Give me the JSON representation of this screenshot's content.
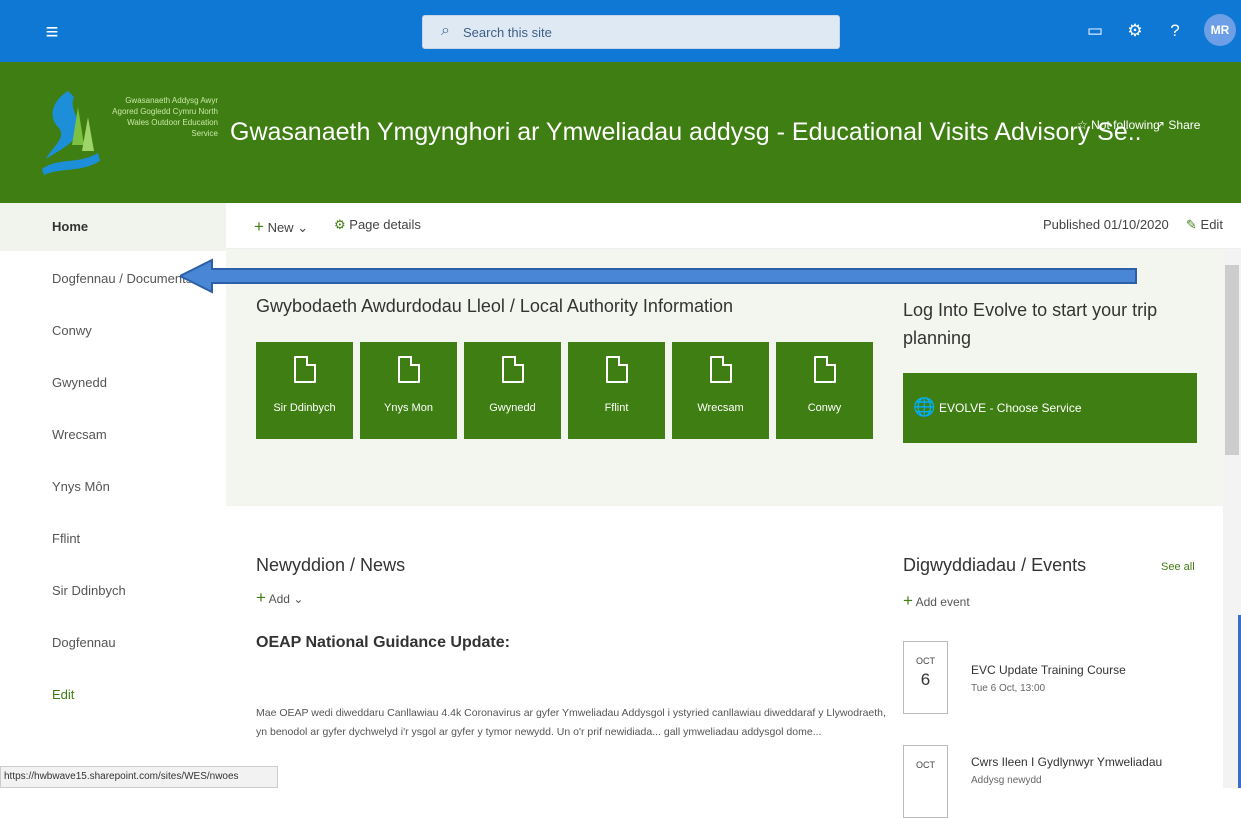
{
  "suite_bar": {
    "search_placeholder": "Search this site",
    "avatar_initials": "MR",
    "icons": [
      "waffle-icon",
      "search-icon",
      "chat-icon",
      "settings-icon",
      "help-icon"
    ]
  },
  "header": {
    "logo_text": "Gwasanaeth Addysg Awyr Agored Gogledd Cymru North Wales Outdoor Education Service",
    "site_title": "Gwasanaeth Ymgynghori ar Ymweliadau addysg - Educational Visits Advisory Se..",
    "follow_label": "Not following",
    "share_label": "Share"
  },
  "nav": {
    "items": [
      {
        "label": "Home",
        "active": true
      },
      {
        "label": "Dogfennau / Documents"
      },
      {
        "label": "Conwy"
      },
      {
        "label": "Gwynedd"
      },
      {
        "label": "Wrecsam"
      },
      {
        "label": "Ynys Môn"
      },
      {
        "label": "Fflint"
      },
      {
        "label": "Sir Ddinbych"
      },
      {
        "label": "Dogfennau"
      }
    ],
    "edit_label": "Edit"
  },
  "command_bar": {
    "new_label": "New",
    "page_details_label": "Page details",
    "published_label": "Published 01/10/2020",
    "edit_label": "Edit"
  },
  "local_authority": {
    "heading": "Gwybodaeth Awdurdodau Lleol / Local Authority Information",
    "tiles": [
      "Sir Ddinbych",
      "Ynys Mon",
      "Gwynedd",
      "Fflint",
      "Wrecsam",
      "Conwy"
    ]
  },
  "evolve": {
    "heading": "Log Into Evolve to start your trip planning",
    "button_label": "EVOLVE - Choose Service"
  },
  "news": {
    "heading": "Newyddion / News",
    "add_label": "Add",
    "article_title": "OEAP National Guidance Update:",
    "article_body": "Mae OEAP wedi diweddaru Canllawiau 4.4k Coronavirus ar gyfer Ymweliadau Addysgol i ystyried canllawiau diweddaraf y Llywodraeth, yn benodol ar gyfer dychwelyd i'r ysgol ar gyfer y tymor newydd. Un o'r prif newidiada... gall ymweliadau addysgol dome..."
  },
  "events": {
    "heading": "Digwyddiadau / Events",
    "see_all": "See all",
    "add_label": "Add event",
    "items": [
      {
        "month": "OCT",
        "day": "6",
        "title": "EVC Update Training Course",
        "time": "Tue 6 Oct, 13:00"
      },
      {
        "month": "OCT",
        "day": "",
        "title": "Cwrs Ileen I Gydlynwyr Ymweliadau",
        "time": "Addysg newydd"
      }
    ]
  },
  "status_url": "https://hwbwave15.sharepoint.com/sites/WES/nwoes",
  "colors": {
    "suite_blue": "#0f78d4",
    "brand_green": "#3f7e12",
    "arrow_blue": "#4a86d6"
  }
}
